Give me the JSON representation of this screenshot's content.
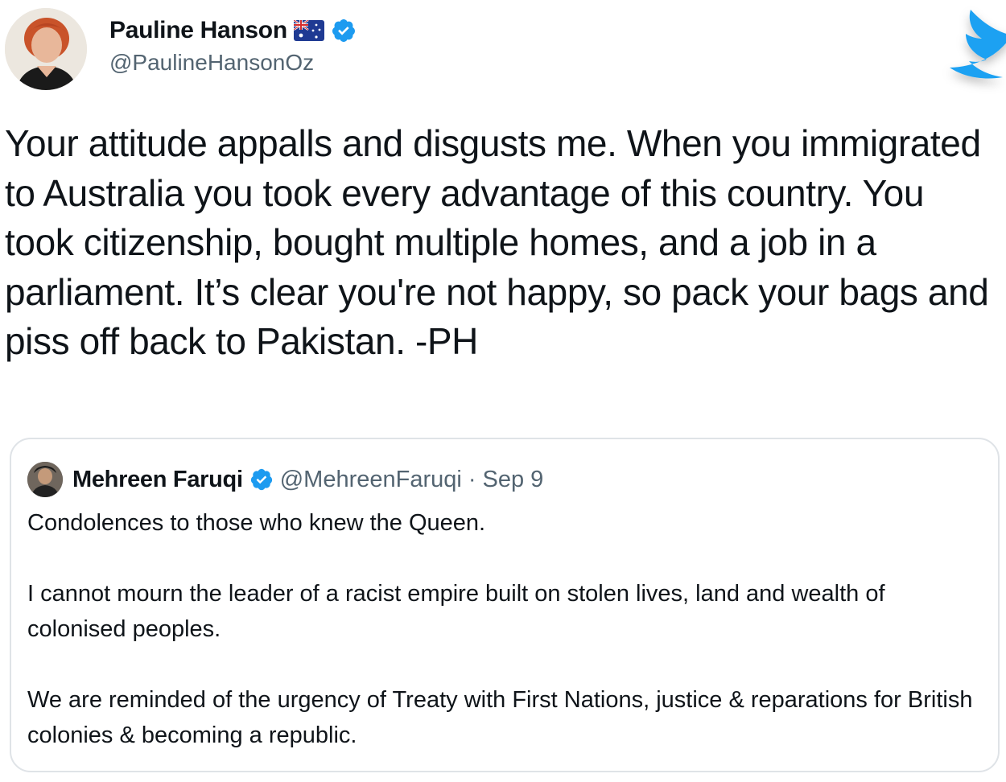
{
  "tweet": {
    "author_name": "Pauline Hanson",
    "author_handle": "@PaulineHansonOz",
    "icons": [
      "australian-flag-icon",
      "verified-badge-icon",
      "twitter-bird-logo"
    ],
    "text": "Your attitude appalls and disgusts me. When you immigrated to Australia you took every advantage of this country. You took citizenship, bought multiple homes, and a job in a parliament. It’s clear you're not happy, so pack your bags and piss off back to Pakistan. -PH"
  },
  "quoted_tweet": {
    "author_name": "Mehreen Faruqi",
    "author_handle": "@MehreenFaruqi",
    "separator": "·",
    "date": "Sep 9",
    "paragraphs": [
      "Condolences to those who knew the Queen.",
      "I cannot mourn the leader of a racist empire built on stolen lives, land and wealth of colonised peoples.",
      "We are reminded of the urgency of Treaty with First Nations, justice & reparations for British colonies & becoming a republic."
    ]
  },
  "colors": {
    "verified_blue": "#1d9bf0",
    "twitter_blue": "#1da1f2",
    "text_primary": "#0f1419",
    "text_secondary": "#536471",
    "card_border": "#dfe3e7"
  }
}
